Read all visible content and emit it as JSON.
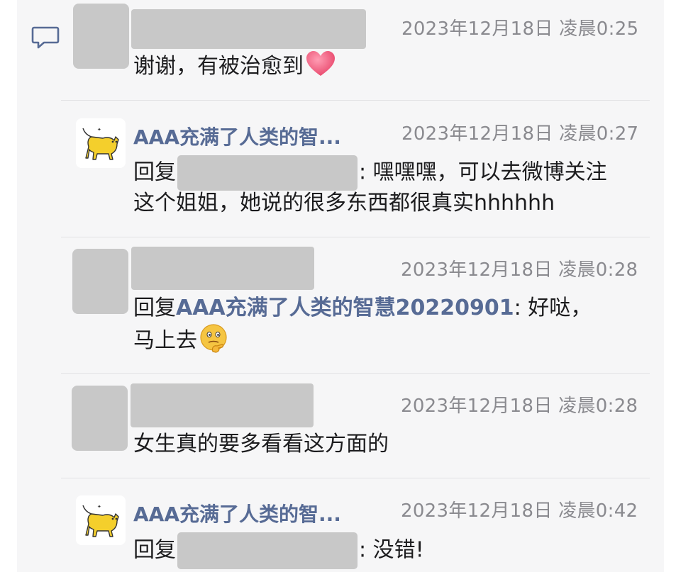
{
  "comments": [
    {
      "time": "2023年12月18日 凌晨0:25",
      "text": "谢谢，有被治愈到",
      "emoji": "heart-emoji"
    },
    {
      "author": "AAA充满了人类的智...",
      "time": "2023年12月18日 凌晨0:27",
      "reply_prefix": "回复",
      "line1_rest": ": 嘿嘿嘿，可以去微博关注",
      "line2": "这个姐姐，她说的很多东西都很真实hhhhhh"
    },
    {
      "time": "2023年12月18日 凌晨0:28",
      "reply_prefix": "回复",
      "mention": "AAA充满了人类的智慧20220901",
      "line1_rest": ": 好哒，",
      "line2": "马上去",
      "emoji": "thinking-face-emoji"
    },
    {
      "time": "2023年12月18日 凌晨0:28",
      "text": "女生真的要多看看这方面的"
    },
    {
      "author": "AAA充满了人类的智...",
      "time": "2023年12月18日 凌晨0:42",
      "reply_prefix": "回复",
      "line1_rest": ": 没错!"
    }
  ],
  "icons": {
    "comment": "comment-bubble-icon",
    "avatar": "yellow-cat-avatar"
  },
  "colors": {
    "link": "#576b95",
    "time": "#8a8a8f",
    "background": "#f6f6f7",
    "redacted": "#c8c8c8"
  }
}
